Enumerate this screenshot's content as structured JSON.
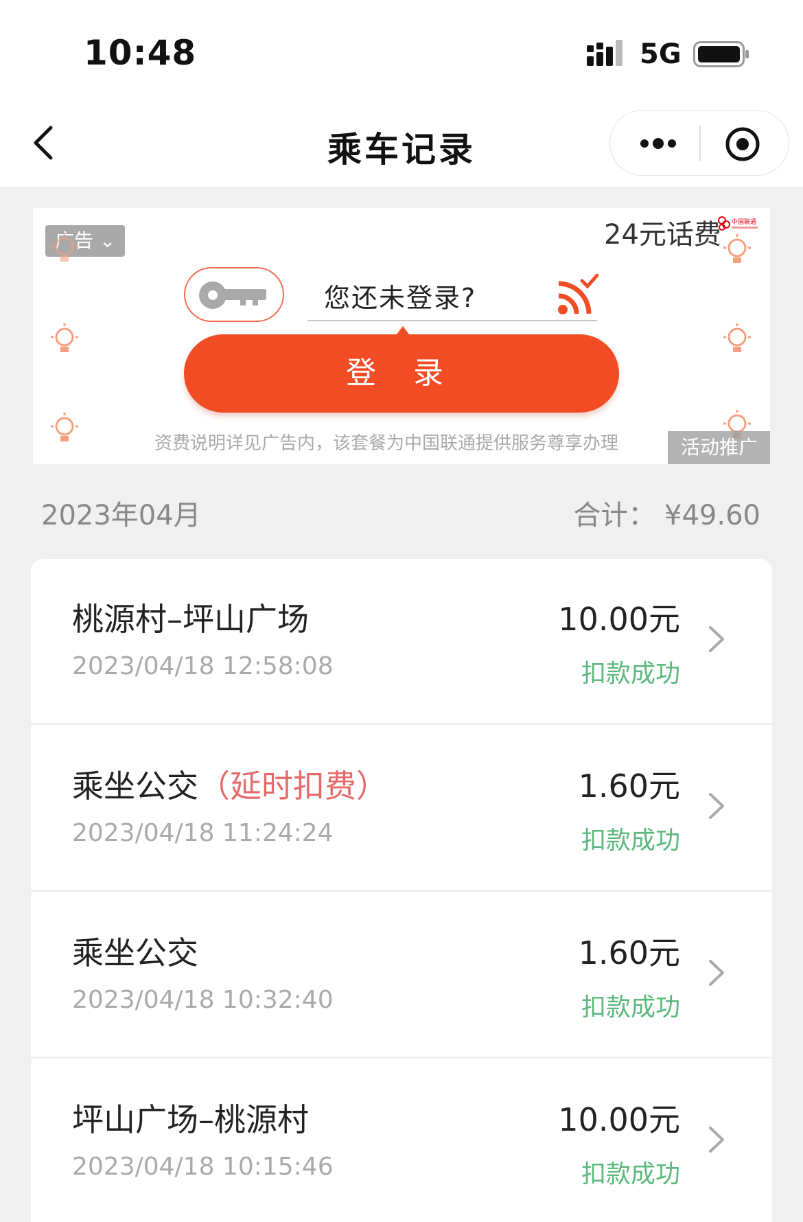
{
  "status_bar": {
    "time": "10:48",
    "network": "5G"
  },
  "nav": {
    "title": "乘车记录"
  },
  "ad": {
    "tag": "广告",
    "price": "24元话费",
    "login_prompt": "您还未登录?",
    "login_button": "登 录",
    "footnote": "资费说明详见广告内，该套餐为中国联通提供服务尊享办理",
    "promo_tag": "活动推广",
    "logo_text": "中国联通"
  },
  "summary": {
    "month": "2023年04月",
    "total": "合计：  ¥49.60"
  },
  "records": [
    {
      "title": "桃源村–坪山广场",
      "delay": "",
      "time": "2023/04/18 12:58:08",
      "amount": "10.00元",
      "status": "扣款成功"
    },
    {
      "title": "乘坐公交",
      "delay": "（延时扣费）",
      "time": "2023/04/18 11:24:24",
      "amount": "1.60元",
      "status": "扣款成功"
    },
    {
      "title": "乘坐公交",
      "delay": "",
      "time": "2023/04/18 10:32:40",
      "amount": "1.60元",
      "status": "扣款成功"
    },
    {
      "title": "坪山广场–桃源村",
      "delay": "",
      "time": "2023/04/18 10:15:46",
      "amount": "10.00元",
      "status": "扣款成功"
    }
  ],
  "colors": {
    "accent": "#f24c25",
    "success": "#5cb87d",
    "delay": "#e46a6a"
  }
}
